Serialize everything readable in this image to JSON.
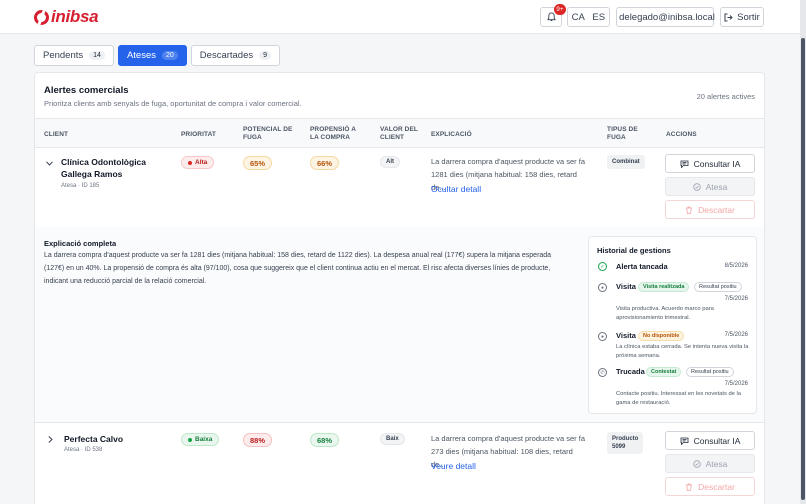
{
  "brand": {
    "name": "inibsa",
    "color": "#d61f31"
  },
  "header": {
    "notif_count": "9+",
    "lang_ca": "CA",
    "lang_es": "ES",
    "user_email": "delegado@inibsa.local",
    "logout_label": "Sortir"
  },
  "tabs": [
    {
      "label": "Pendents",
      "count": "14"
    },
    {
      "label": "Ateses",
      "count": "20",
      "active": true
    },
    {
      "label": "Descartades",
      "count": "9"
    }
  ],
  "card": {
    "title": "Alertes comercials",
    "subtitle": "Prioritza clients amb senyals de fuga, oportunitat de compra i valor comercial.",
    "active_count": "20 alertes actives"
  },
  "columns": {
    "client": "CLIENT",
    "prioritat": "PRIORITAT",
    "fuga_1": "POTENCIAL DE",
    "fuga_2": "FUGA",
    "prop_1": "PROPENSIÓ A",
    "prop_2": "LA COMPRA",
    "valor_1": "VALOR DEL",
    "valor_2": "CLIENT",
    "explicacio": "EXPLICACIÓ",
    "tipus_1": "TIPUS DE",
    "tipus_2": "FUGA",
    "accions": "ACCIONS"
  },
  "rows": [
    {
      "name_1": "Clínica Odontològica",
      "name_2": "Gallega Ramos",
      "meta": "Atesa · ID 185",
      "priority": "Alta",
      "fuga": "65%",
      "propensio": "66%",
      "valor": "Alt",
      "expl_1": "La darrera compra d'aquest producte va ser fa",
      "expl_2": "1281 dies (mitjana habitual: 158 dies, retard de...",
      "link": "Ocultar detall",
      "tipus": "Combinat",
      "btn_consult": "Consultar IA",
      "btn_atesa": "Atesa",
      "btn_descartar": "Descartar"
    },
    {
      "name_1": "Perfecta Calvo",
      "meta": "Atesa · ID 538",
      "priority": "Baixa",
      "fuga": "88%",
      "propensio": "68%",
      "valor": "Baix",
      "expl_1": "La darrera compra d'aquest producte va ser fa",
      "expl_2": "273 dies (mitjana habitual: 108 dies, retard de...",
      "link": "Veure detall",
      "tipus_1": "Producto",
      "tipus_2": "5099",
      "btn_consult": "Consultar IA",
      "btn_atesa": "Atesa",
      "btn_descartar": "Descartar"
    }
  ],
  "detail": {
    "title": "Explicació completa",
    "text": "La darrera compra d'aquest producte va ser fa 1281 dies (mitjana habitual: 158 dies, retard de 1122 dies). La despesa anual real (177€) supera la mitjana esperada (127€) en un 40%. La propensió de compra és alta (97/100), cosa que suggereix que el client continua actiu en el mercat. El risc afecta diverses línies de producte, indicant una reducció parcial de la relació comercial."
  },
  "history": {
    "title": "Historial de gestions",
    "items": [
      {
        "icon": "check-icon",
        "name": "Alerta tancada",
        "date": "8/5/2026"
      },
      {
        "icon": "map-pin-icon",
        "name": "Visita",
        "status": "Visita realitzada",
        "result": "Resultat positiu",
        "date": "7/5/2026",
        "note": "Visita productiva. Acuerdo marco para aprovisionamiento trimestral."
      },
      {
        "icon": "map-pin-icon",
        "name": "Visita",
        "status": "No disponible",
        "date": "7/5/2026",
        "note": "La clínica estaba cerrada. Se intenta nueva visita la próxima semana."
      },
      {
        "icon": "phone-icon",
        "name": "Trucada",
        "status": "Contestat",
        "result": "Resultat positiu",
        "date": "7/5/2026",
        "note": "Contacte positiu. Interessat en les novetats de la gama de restauració."
      }
    ]
  }
}
